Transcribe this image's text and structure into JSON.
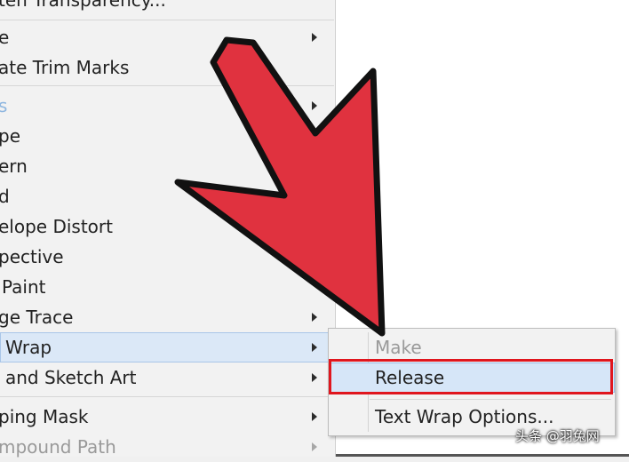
{
  "menu": {
    "items": [
      {
        "label": "ten Transparency...",
        "arrow": false,
        "disabled": false
      },
      {
        "label": "e",
        "arrow": true,
        "disabled": false
      },
      {
        "label": "ate Trim Marks",
        "arrow": false,
        "disabled": false
      },
      {
        "label": "s",
        "arrow": true,
        "disabled": false
      },
      {
        "label": "pe",
        "arrow": true,
        "disabled": false
      },
      {
        "label": "ern",
        "arrow": false,
        "disabled": false
      },
      {
        "label": "d",
        "arrow": false,
        "disabled": false
      },
      {
        "label": "elope Distort",
        "arrow": false,
        "disabled": false
      },
      {
        "label": "pective",
        "arrow": false,
        "disabled": false
      },
      {
        "label": "Paint",
        "arrow": false,
        "disabled": false
      },
      {
        "label": "ge Trace",
        "arrow": true,
        "disabled": false
      },
      {
        "label": "Wrap",
        "arrow": true,
        "disabled": false
      },
      {
        "label": "and Sketch Art",
        "arrow": true,
        "disabled": false
      },
      {
        "label": "ping Mask",
        "arrow": true,
        "disabled": false
      },
      {
        "label": "mpound Path",
        "arrow": true,
        "disabled": true
      }
    ]
  },
  "submenu": {
    "make_label": "Make",
    "release_label": "Release",
    "options_label": "Text Wrap Options..."
  },
  "watermark": "头条 @羽兔网",
  "colors": {
    "highlight_box": "#e0161e",
    "pointer_arrow": "#e0323f",
    "menu_bg": "#f2f2f2",
    "hover_bg": "#dbe8f7"
  }
}
